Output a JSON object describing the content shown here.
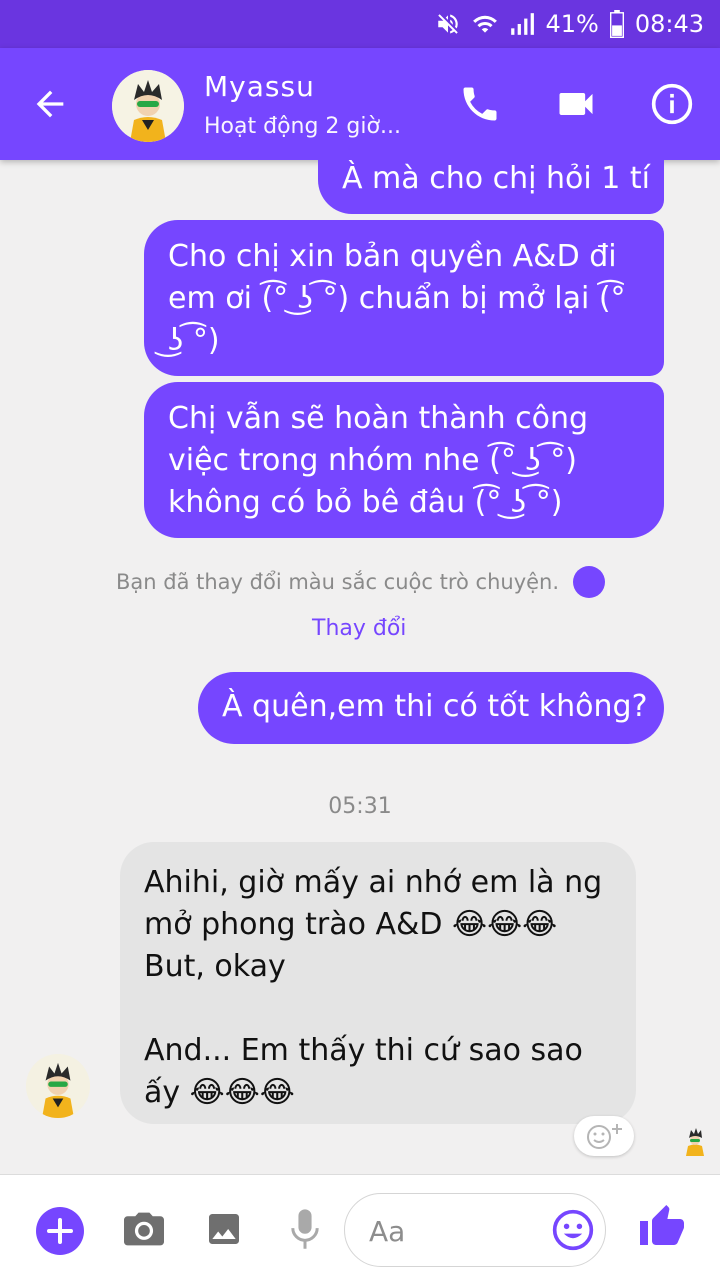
{
  "status_bar": {
    "battery": "41%",
    "time": "08:43"
  },
  "header": {
    "contact_name": "Myassu",
    "contact_status": "Hoạt động 2 giờ..."
  },
  "messages_outgoing": [
    "À mà cho chị hỏi 1 tí",
    "Cho chị xin bản quyền A&D đi em ơi (͡° ͜ʖ ͡°) chuẩn bị mở lại (͡° ͜ʖ ͡°)",
    "Chị vẫn sẽ hoàn thành công việc trong nhóm nhe (͡° ͜ʖ ͡°) không có bỏ bê đâu (͡° ͜ʖ ͡°)"
  ],
  "system_note": {
    "text": "Bạn đã thay đổi màu sắc cuộc trò chuyện.",
    "action": "Thay đổi"
  },
  "message_outgoing_last": "À quên,em thi có tốt không?",
  "timestamp": "05:31",
  "message_incoming": "Ahihi, giờ mấy ai nhớ em là ng mở phong trào A&D 😂😂😂\nBut, okay\n\nAnd... Em thấy thi cứ sao sao ấy 😂😂😂",
  "composer": {
    "placeholder": "Aa"
  },
  "colors": {
    "accent": "#7646ff",
    "incoming_bubble": "#e4e4e4",
    "background": "#f1f0f0"
  }
}
